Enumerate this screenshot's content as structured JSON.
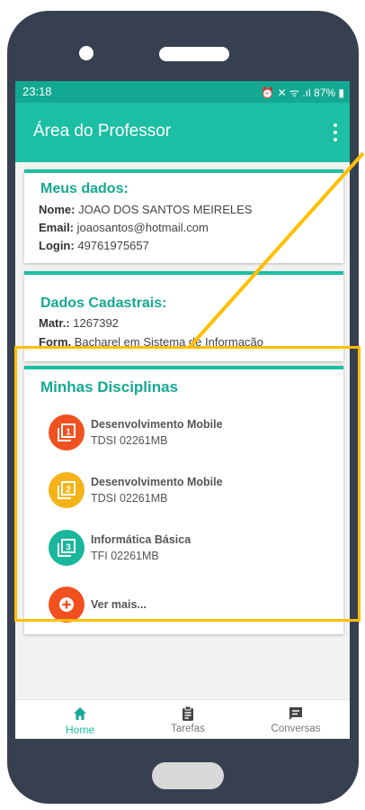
{
  "status_bar": {
    "time": "23:18",
    "icons": "⏰ ✕ ᯤ .ıl",
    "battery": "87%"
  },
  "app_bar": {
    "title": "Área do Professor",
    "menu_icon": "more-vert-icon"
  },
  "meus_dados": {
    "title": "Meus dados:",
    "fields": [
      {
        "label": "Nome:",
        "value": "JOAO DOS SANTOS MEIRELES"
      },
      {
        "label": "Email:",
        "value": "joaosantos@hotmail.com"
      },
      {
        "label": "Login:",
        "value": "49761975657"
      }
    ]
  },
  "dados_cadastrais": {
    "title": "Dados Cadastrais:",
    "fields": [
      {
        "label": "Matr.:",
        "value": "1267392"
      },
      {
        "label": "Form.",
        "value": "Bacharel em Sistema de Informação"
      }
    ]
  },
  "disciplinas": {
    "title": "Minhas Disciplinas",
    "items": [
      {
        "name": "Desenvolvimento Mobile",
        "code": "TDSI 02261MB",
        "number": "1",
        "color": "#f0511e"
      },
      {
        "name": "Desenvolvimento Mobile",
        "code": "TDSI 02261MB",
        "number": "2",
        "color": "#f5b319"
      },
      {
        "name": "Informática Básica",
        "code": "TFI 02261MB",
        "number": "3",
        "color": "#19b79b"
      }
    ],
    "more": {
      "label": "Ver mais...",
      "color": "#f0511e"
    }
  },
  "bottom_nav": [
    {
      "label": "Home",
      "icon": "home-icon",
      "active": true
    },
    {
      "label": "Tarefas",
      "icon": "clipboard-icon",
      "active": false
    },
    {
      "label": "Conversas",
      "icon": "chat-icon",
      "active": false
    }
  ],
  "colors": {
    "primary": "#1cbfa3",
    "status_bar": "#13a892",
    "highlight": "#ffbf00",
    "phone_frame": "#364050"
  }
}
